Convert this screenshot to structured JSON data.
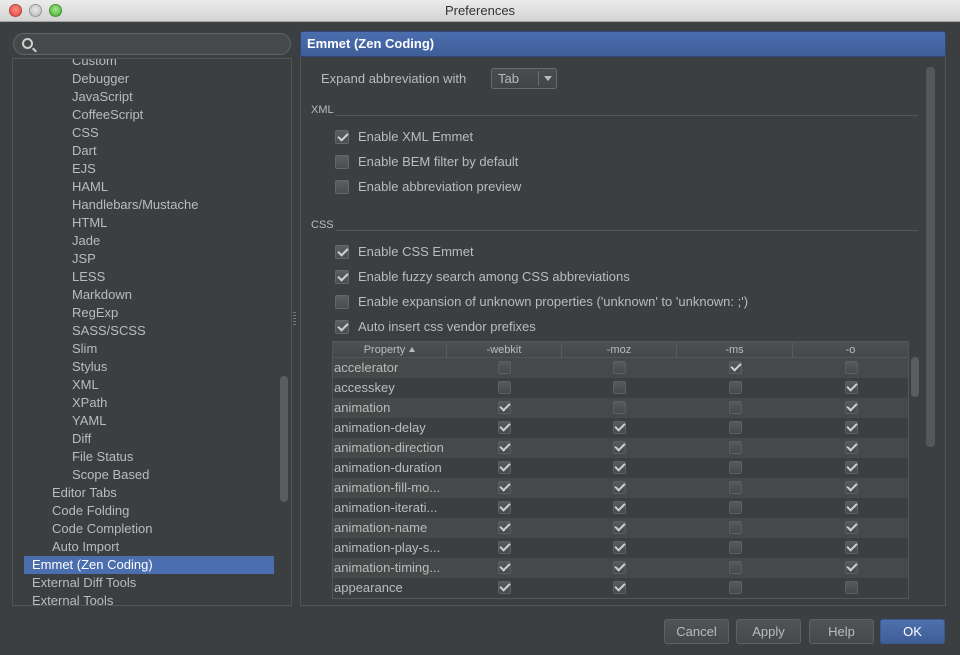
{
  "window": {
    "title": "Preferences"
  },
  "search": {
    "placeholder": "",
    "value": ""
  },
  "tree": {
    "items": [
      {
        "label": "Custom",
        "indent": 2
      },
      {
        "label": "Debugger",
        "indent": 2
      },
      {
        "label": "JavaScript",
        "indent": 2
      },
      {
        "label": "CoffeeScript",
        "indent": 2
      },
      {
        "label": "CSS",
        "indent": 2
      },
      {
        "label": "Dart",
        "indent": 2
      },
      {
        "label": "EJS",
        "indent": 2
      },
      {
        "label": "HAML",
        "indent": 2
      },
      {
        "label": "Handlebars/Mustache",
        "indent": 2
      },
      {
        "label": "HTML",
        "indent": 2
      },
      {
        "label": "Jade",
        "indent": 2
      },
      {
        "label": "JSP",
        "indent": 2
      },
      {
        "label": "LESS",
        "indent": 2
      },
      {
        "label": "Markdown",
        "indent": 2
      },
      {
        "label": "RegExp",
        "indent": 2
      },
      {
        "label": "SASS/SCSS",
        "indent": 2
      },
      {
        "label": "Slim",
        "indent": 2
      },
      {
        "label": "Stylus",
        "indent": 2
      },
      {
        "label": "XML",
        "indent": 2
      },
      {
        "label": "XPath",
        "indent": 2
      },
      {
        "label": "YAML",
        "indent": 2
      },
      {
        "label": "Diff",
        "indent": 2
      },
      {
        "label": "File Status",
        "indent": 2
      },
      {
        "label": "Scope Based",
        "indent": 2
      },
      {
        "label": "Editor Tabs",
        "indent": 1
      },
      {
        "label": "Code Folding",
        "indent": 1
      },
      {
        "label": "Code Completion",
        "indent": 1
      },
      {
        "label": "Auto Import",
        "indent": 1
      },
      {
        "label": "Emmet (Zen Coding)",
        "indent": 0,
        "selected": true
      },
      {
        "label": "External Diff Tools",
        "indent": 0
      },
      {
        "label": "External Tools",
        "indent": 0
      }
    ]
  },
  "panel": {
    "title": "Emmet (Zen Coding)",
    "expand_label": "Expand abbreviation with",
    "expand_value": "Tab",
    "xml_section": "XML",
    "css_section": "CSS",
    "xml_options": [
      {
        "label": "Enable XML Emmet",
        "checked": true
      },
      {
        "label": "Enable BEM filter by default",
        "checked": false
      },
      {
        "label": "Enable abbreviation preview",
        "checked": false
      }
    ],
    "css_options": [
      {
        "label": "Enable CSS Emmet",
        "checked": true
      },
      {
        "label": "Enable fuzzy search among CSS abbreviations",
        "checked": true
      },
      {
        "label": "Enable expansion of unknown properties ('unknown' to 'unknown: ;')",
        "checked": false
      },
      {
        "label": "Auto insert css vendor prefixes",
        "checked": true
      }
    ]
  },
  "vendor_table": {
    "headers": [
      "Property",
      "-webkit",
      "-moz",
      "-ms",
      "-o"
    ],
    "rows": [
      {
        "property": "accelerator",
        "webkit": false,
        "moz": false,
        "ms": true,
        "o": false
      },
      {
        "property": "accesskey",
        "webkit": false,
        "moz": false,
        "ms": false,
        "o": true
      },
      {
        "property": "animation",
        "webkit": true,
        "moz": false,
        "ms": false,
        "o": true
      },
      {
        "property": "animation-delay",
        "webkit": true,
        "moz": true,
        "ms": false,
        "o": true
      },
      {
        "property": "animation-direction",
        "webkit": true,
        "moz": true,
        "ms": false,
        "o": true
      },
      {
        "property": "animation-duration",
        "webkit": true,
        "moz": true,
        "ms": false,
        "o": true
      },
      {
        "property": "animation-fill-mo...",
        "webkit": true,
        "moz": true,
        "ms": false,
        "o": true
      },
      {
        "property": "animation-iterati...",
        "webkit": true,
        "moz": true,
        "ms": false,
        "o": true
      },
      {
        "property": "animation-name",
        "webkit": true,
        "moz": true,
        "ms": false,
        "o": true
      },
      {
        "property": "animation-play-s...",
        "webkit": true,
        "moz": true,
        "ms": false,
        "o": true
      },
      {
        "property": "animation-timing...",
        "webkit": true,
        "moz": true,
        "ms": false,
        "o": true
      },
      {
        "property": "appearance",
        "webkit": true,
        "moz": true,
        "ms": false,
        "o": false
      }
    ]
  },
  "buttons": {
    "cancel": "Cancel",
    "apply": "Apply",
    "help": "Help",
    "ok": "OK"
  }
}
